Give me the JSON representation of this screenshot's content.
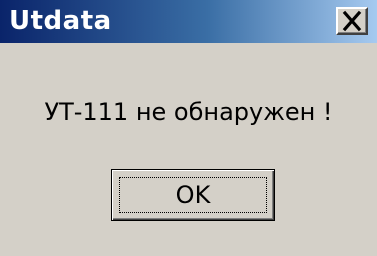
{
  "window": {
    "title": "Utdata",
    "close_icon": "close-icon"
  },
  "dialog": {
    "message": "УТ-111 не обнаружен !",
    "ok_label": "OK"
  },
  "colors": {
    "titlebar_start": "#0a246a",
    "titlebar_end": "#a6caf0",
    "face": "#d4d0c8",
    "title_text": "#ffffff"
  }
}
